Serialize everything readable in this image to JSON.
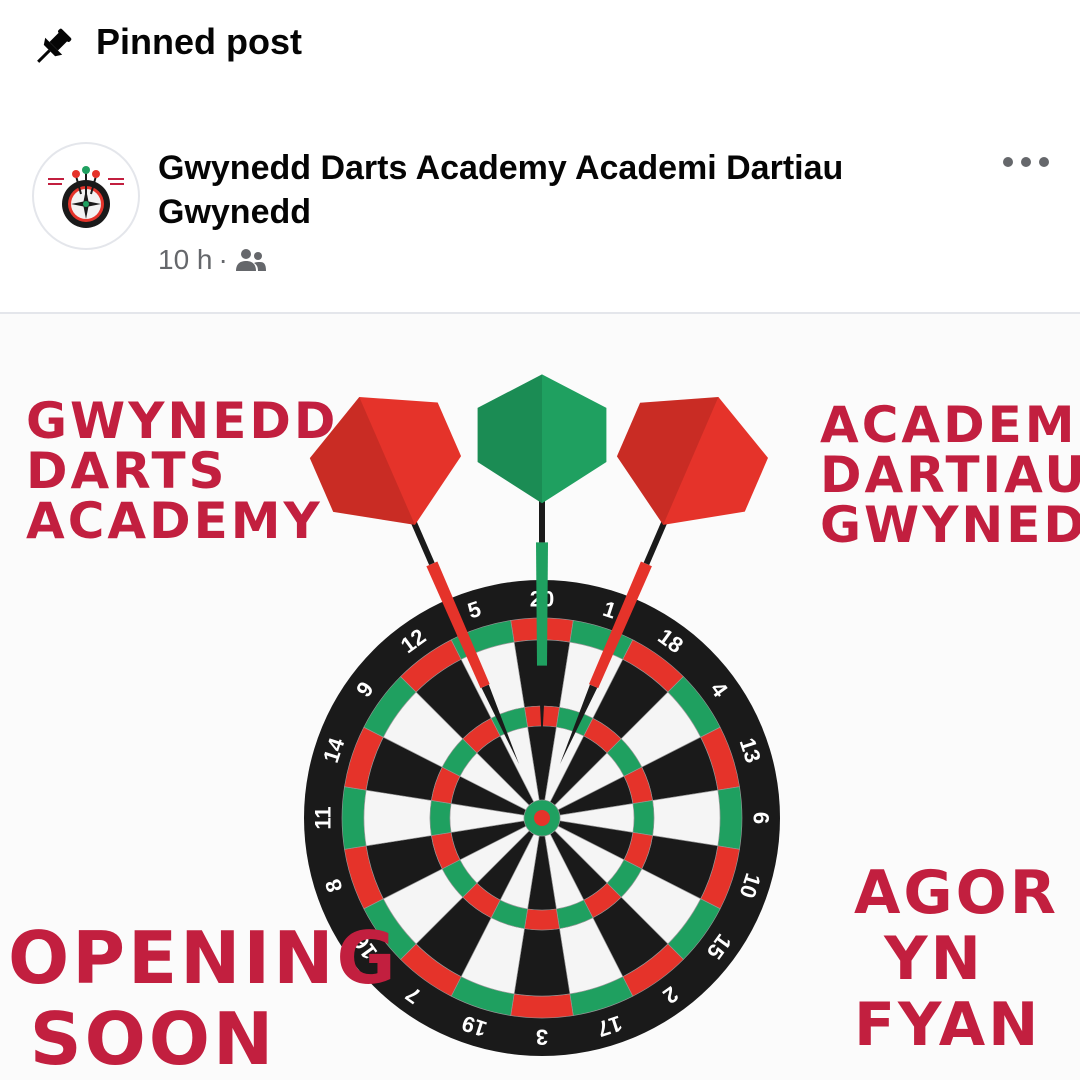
{
  "pinned": {
    "label": "Pinned post",
    "icon": "pin-icon"
  },
  "post": {
    "author": "Gwynedd Darts Academy Academi Dartiau Gwynedd",
    "time": "10 h",
    "separator": "·",
    "audience_icon": "group-icon",
    "more_icon": "more-options-icon"
  },
  "image": {
    "left_title": "Gwynedd Darts Academy",
    "right_title": "Academi Dartiau Gwynedd",
    "opening": "Opening Soon",
    "agor": "Agor yn fyan",
    "board_numbers": [
      "20",
      "1",
      "18",
      "4",
      "13",
      "6",
      "10",
      "15",
      "2",
      "17",
      "3",
      "19",
      "7",
      "16",
      "8",
      "11",
      "14",
      "9",
      "12",
      "5"
    ],
    "colors": {
      "red": "#e5332a",
      "green": "#1fa060",
      "black": "#1a1a1a",
      "title": "#c21f3f"
    }
  }
}
